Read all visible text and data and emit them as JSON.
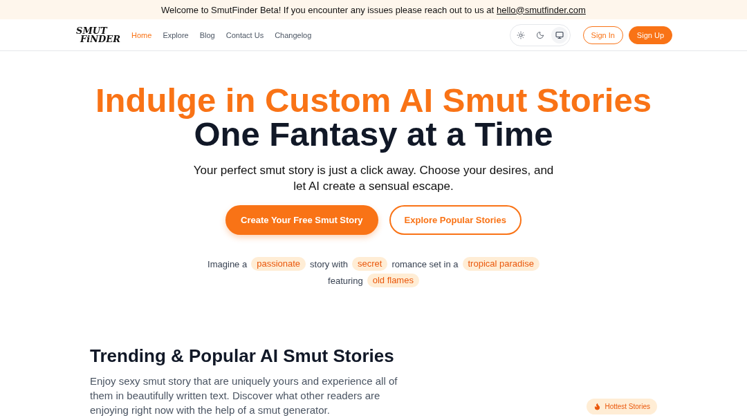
{
  "banner": {
    "text": "Welcome to SmutFinder Beta! If you encounter any issues please reach out to us at",
    "link": "hello@smutfinder.com"
  },
  "logo": {
    "line_1": "SMUT",
    "line_2": "FiNDER"
  },
  "nav": [
    {
      "label": "Home",
      "selected": true
    },
    {
      "label": "Explore",
      "selected": false
    },
    {
      "label": "Blog",
      "selected": false
    },
    {
      "label": "Contact Us",
      "selected": false
    },
    {
      "label": "Changelog",
      "selected": false
    }
  ],
  "theme_toggle": [
    {
      "kind": "sun",
      "selected": false
    },
    {
      "kind": "moon",
      "selected": false
    },
    {
      "kind": "monitor",
      "selected": true
    }
  ],
  "auth_buttons": [
    {
      "label": "Sign In",
      "kind": "outline"
    },
    {
      "label": "Sign Up",
      "kind": "filled"
    }
  ],
  "hero": {
    "title_line_1": "Indulge in Custom AI Smut Stories",
    "title_line_2": "One Fantasy at a Time",
    "subtitle": "Your perfect smut story is just a click away. Choose your desires, and let AI create a sensual escape.",
    "buttons": [
      {
        "label": "Create Your Free Smut Story",
        "kind": "filled"
      },
      {
        "label": "Explore Popular Stories",
        "kind": "outline"
      }
    ],
    "prompt": [
      {
        "kind": "text",
        "text": "Imagine a"
      },
      {
        "kind": "tag",
        "text": "passionate"
      },
      {
        "kind": "text",
        "text": "story with"
      },
      {
        "kind": "tag",
        "text": "secret"
      },
      {
        "kind": "text",
        "text": "romance set in a"
      },
      {
        "kind": "tag",
        "text": "tropical paradise"
      },
      {
        "kind": "text",
        "text": "featuring"
      },
      {
        "kind": "tag",
        "text": "old flames"
      }
    ]
  },
  "trending": {
    "heading": "Trending & Popular AI Smut Stories",
    "description": "Enjoy sexy smut story that are uniquely yours and experience all of them in beautifully written text. Discover what other readers are enjoying right now with the help of a smut generator.",
    "badge": "Hottest Stories"
  }
}
